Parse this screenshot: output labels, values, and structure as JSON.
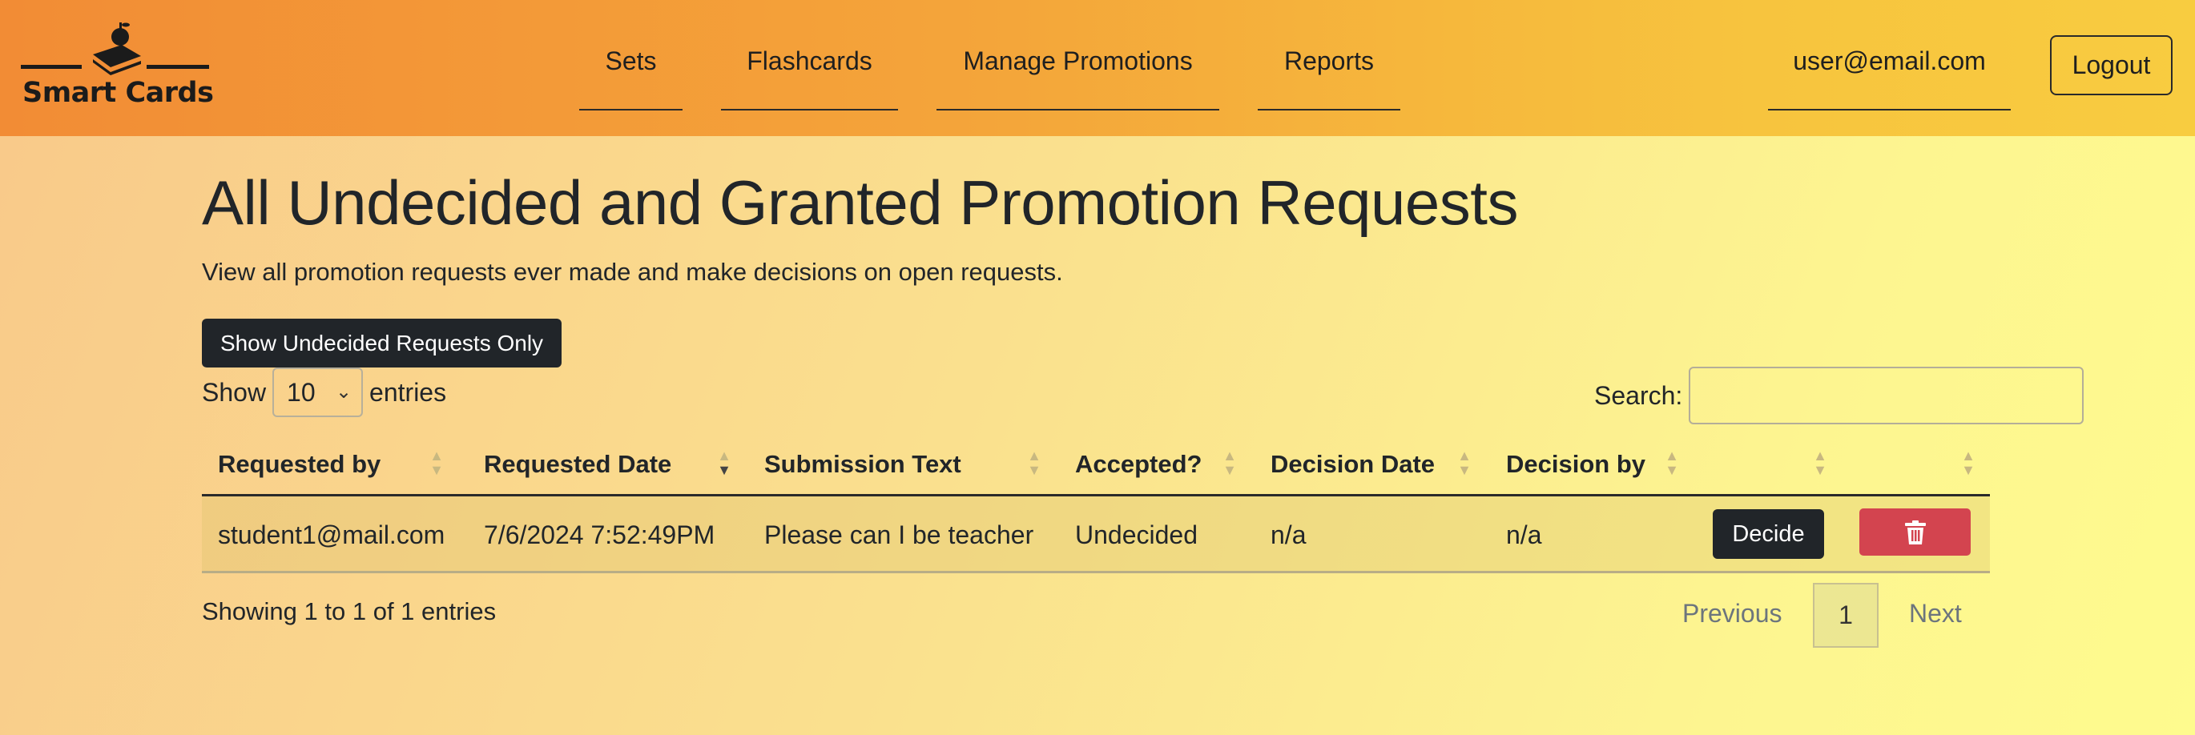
{
  "brand": {
    "name": "Smart Cards",
    "logo_icon": "book-apple-icon"
  },
  "nav": {
    "items": [
      {
        "label": "Sets"
      },
      {
        "label": "Flashcards"
      },
      {
        "label": "Manage Promotions"
      },
      {
        "label": "Reports"
      }
    ],
    "user_email": "user@email.com",
    "logout_label": "Logout"
  },
  "page": {
    "title": "All Undecided and Granted Promotion Requests",
    "subtitle": "View all promotion requests ever made and make decisions on open requests.",
    "filter_button": "Show Undecided Requests Only"
  },
  "table_controls": {
    "show_label": "Show",
    "page_length": "10",
    "entries_label": "entries",
    "search_label": "Search:",
    "search_value": ""
  },
  "table": {
    "columns": [
      "Requested by",
      "Requested Date",
      "Submission Text",
      "Accepted?",
      "Decision Date",
      "Decision by",
      "",
      ""
    ],
    "sorted_column": "Requested Date",
    "sort_direction": "descending",
    "rows": [
      {
        "requested_by": "student1@mail.com",
        "requested_date": "7/6/2024 7:52:49PM",
        "submission_text": "Please can I be teacher",
        "accepted": "Undecided",
        "decision_date": "n/a",
        "decision_by": "n/a",
        "decide_label": "Decide",
        "delete_icon": "trash-icon"
      }
    ]
  },
  "footer": {
    "info": "Showing 1 to 1 of 1 entries",
    "previous_label": "Previous",
    "current_page": "1",
    "next_label": "Next"
  },
  "colors": {
    "navbar_start": "#f28c35",
    "navbar_end": "#f8cc40",
    "dark_button": "#212529",
    "danger_button": "#d3444f"
  }
}
